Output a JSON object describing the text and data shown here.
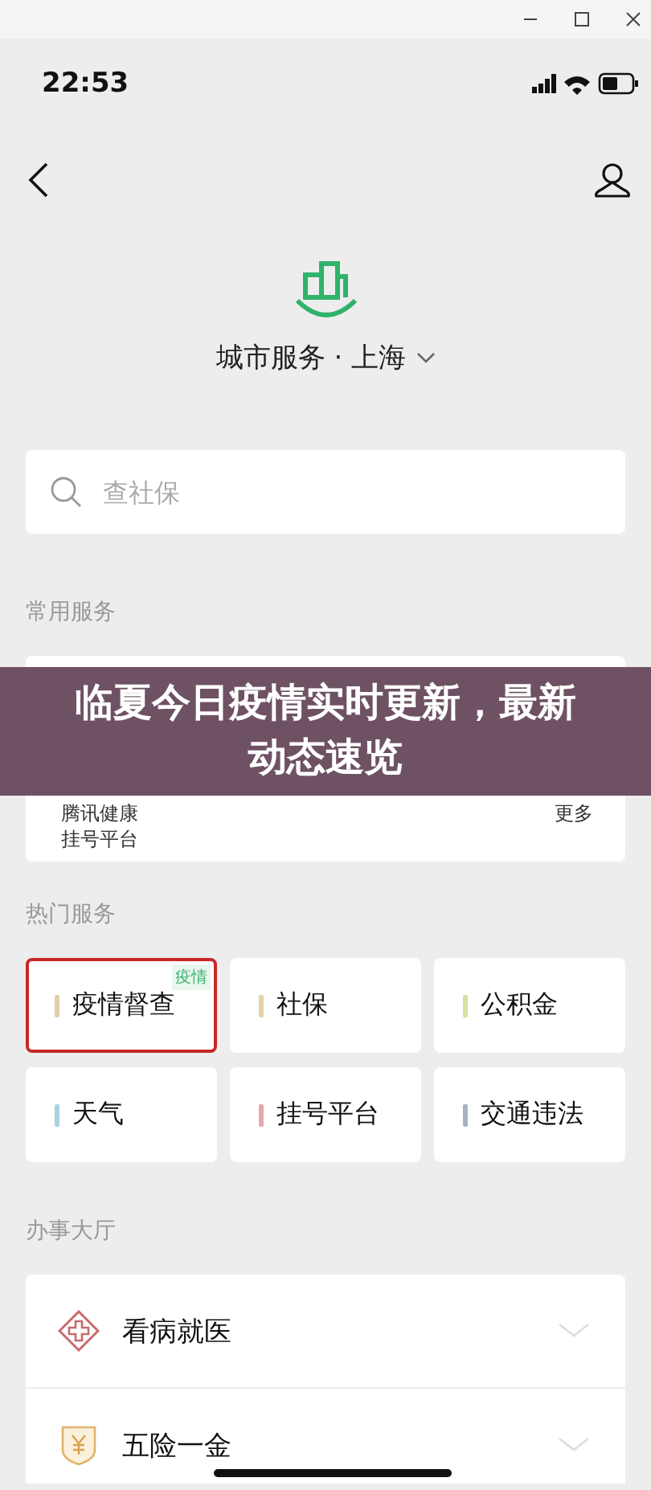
{
  "status_bar": {
    "time": "22:53"
  },
  "header": {
    "title": "城市服务 · 上海"
  },
  "search": {
    "placeholder": "查社保"
  },
  "common": {
    "heading": "常用服务",
    "items": [
      {
        "label": "腾讯健康挂号平台"
      },
      {
        "label": "更多"
      }
    ]
  },
  "hot": {
    "heading": "热门服务",
    "tiles": [
      {
        "label": "疫情督查",
        "tag": "疫情",
        "selected": true,
        "color": "#e0cfa8"
      },
      {
        "label": "社保",
        "selected": false,
        "color": "#e3d3a6"
      },
      {
        "label": "公积金",
        "selected": false,
        "color": "#d8e0a0"
      },
      {
        "label": "天气",
        "selected": false,
        "color": "#a9d2e3"
      },
      {
        "label": "挂号平台",
        "selected": false,
        "color": "#e6a8ad"
      },
      {
        "label": "交通违法",
        "selected": false,
        "color": "#a8b2c2"
      }
    ]
  },
  "hall": {
    "heading": "办事大厅",
    "items": [
      {
        "kind": "medical",
        "label": "看病就医"
      },
      {
        "kind": "insurance",
        "label": "五险一金"
      }
    ]
  },
  "banner": {
    "text": "临夏今日疫情实时更新，最新动态速览"
  }
}
